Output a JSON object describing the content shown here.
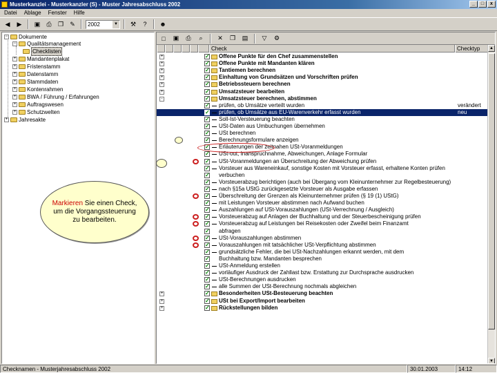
{
  "window": {
    "title": "Musterkanzlei - Musterkanzler (S) - Muster Jahresabschluss 2002",
    "controls": [
      "_",
      "□",
      "x"
    ]
  },
  "menu": [
    "Datei",
    "Ablage",
    "Fenster",
    "Hilfe"
  ],
  "toolbar": {
    "year": "2002",
    "icons": [
      "back-icon",
      "forward-icon",
      "save-icon",
      "print-icon",
      "copy-icon",
      "edit-icon",
      "tools-icon",
      "help-icon"
    ]
  },
  "tree": {
    "root": "Dokumente",
    "items": [
      {
        "label": "Qualitätsmanagement",
        "level": 1,
        "expanded": true
      },
      {
        "label": "Checklisten",
        "level": 2,
        "selected": true
      },
      {
        "label": "Mandantenplakat",
        "level": 1
      },
      {
        "label": "Fristenstamm",
        "level": 1
      },
      {
        "label": "Datenstamm",
        "level": 1
      },
      {
        "label": "Stammdaten",
        "level": 1
      },
      {
        "label": "Kontenrahmen",
        "level": 1
      },
      {
        "label": "BWA / Führung / Erfahrungen",
        "level": 1
      },
      {
        "label": "Auftragswesen",
        "level": 1
      },
      {
        "label": "Schutzwelten",
        "level": 1
      }
    ],
    "bottom": "Jahresakte"
  },
  "grid": {
    "columns": [
      "",
      "Check",
      "Checktyp"
    ],
    "rows": [
      {
        "text": "Offene Punkte für den Chef zusammenstellen",
        "bold": true,
        "exp": "+",
        "folder": true
      },
      {
        "text": "Offene Punkte mit Mandanten klären",
        "bold": true,
        "exp": "+",
        "folder": true
      },
      {
        "text": "Tantiemen berechnen",
        "bold": true,
        "exp": "+",
        "folder": true
      },
      {
        "text": "Einhaltung von Grundsätzen und Vorschriften prüfen",
        "bold": true,
        "exp": "+",
        "folder": true
      },
      {
        "text": "Betriebssteuern berechnen",
        "bold": true,
        "exp": "+",
        "folder": true
      },
      {
        "text": "Umsatzsteuer bearbeiten",
        "bold": true,
        "exp": "+",
        "folder": true
      },
      {
        "text": "Umsatzsteuer berechnen, abstimmen",
        "bold": true,
        "exp": "-",
        "folder": true
      },
      {
        "text": "prüfen, ob Umsätze verteilt wurden",
        "status": "verändert"
      },
      {
        "text": "prüfen, ob Umsätze aus EU-Warenverkehr erfasst wurden",
        "status": "neu",
        "highlight": true
      },
      {
        "text": "Soll-Ist-Versteuerung beachten"
      },
      {
        "text": "USt-Daten aus Umbuchungen übernehmen"
      },
      {
        "text": "USt berechnen",
        "circled": true
      },
      {
        "text": "Berechnungsformulare anzeigen"
      },
      {
        "text": "Erläuterungen der zeitnahen USt-Voranmeldungen"
      },
      {
        "text": "USt-out, Inanspruchnahme, Abweichungen, Anlage Formular"
      },
      {
        "text": "USt-Voranmeldungen an Überschreitung der Abweichung prüfen",
        "warn": true
      },
      {
        "text": "Vorsteuer aus Wareneinkauf, sonstige Kosten mit Vorsteuer erfasst, erhaltene Konten prüfen"
      },
      {
        "text": "verbuchen",
        "indent": true
      },
      {
        "text": "Vorsteuerabzug berichtigen (auch bei Übergang vom Kleinunternehmer zur Regelbesteuerung)"
      },
      {
        "text": "nach §15a UStG zurückgesetzte Vorsteuer als Ausgabe erfassen"
      },
      {
        "text": "Überschreitung der Grenzen als Kleinunternehmer prüfen (§ 19 (1) UStG)",
        "warn": true
      },
      {
        "text": "mit Leistungen Vorsteuer abstimmen nach Aufwand buchen"
      },
      {
        "text": "Auszahlungen auf USt-Vorauszahlungen (USt-Verrechnung / Ausgleich)"
      },
      {
        "text": "Vorsteuerabzug auf Anlagen der Buchhaltung und der Steuerbescheinigung prüfen",
        "warn": true
      },
      {
        "text": "Vorsteuerabzug auf Leistungen bei Reisekosten oder Zweifel beim Finanzamt",
        "warn": true
      },
      {
        "text": "abfragen",
        "indent": true
      },
      {
        "text": "USt-Vorauszahlungen abstimmen",
        "warn": true
      },
      {
        "text": "Vorauszahlungen mit tatsächlicher USt-Verpflichtung abstimmen",
        "warn": true
      },
      {
        "text": "grundsätzliche Fehler, die bei USt-Nachzahlungen erkannt werden, mit dem"
      },
      {
        "text": "Buchhaltung bzw. Mandanten besprechen",
        "indent": true
      },
      {
        "text": "USt-Anmeldung erstellen"
      },
      {
        "text": "vorläufiger Ausdruck der Zahllast bzw. Erstattung zur Durchsprache ausdrucken"
      },
      {
        "text": "USt-Berechnungen ausdrucken"
      },
      {
        "text": "alle Summen der USt-Berechnung nochmals abgleichen"
      },
      {
        "text": "Besonderheiten USt-Besteuerung beachten",
        "bold": true,
        "exp": "+",
        "folder": true
      },
      {
        "text": "USt bei Export/Import bearbeiten",
        "bold": true,
        "exp": "+",
        "folder": true
      },
      {
        "text": "Rückstellungen bilden",
        "bold": true,
        "exp": "+",
        "folder": true
      }
    ]
  },
  "callout": {
    "highlight": "Markieren",
    "text": " Sie einen Check, um die Vorgangssteuerung zu bearbeiten."
  },
  "statusbar": {
    "left": "Checknamen - Musterjahresabschluss 2002",
    "date": "30.01.2003",
    "time": "14:12"
  },
  "colors": {
    "title_gradient_start": "#0a246a",
    "selection": "#0a246a",
    "check": "#0a8a0a",
    "warning": "#cc2020",
    "callout_fill": "#ffffcc",
    "callout_highlight": "#cc0000"
  }
}
